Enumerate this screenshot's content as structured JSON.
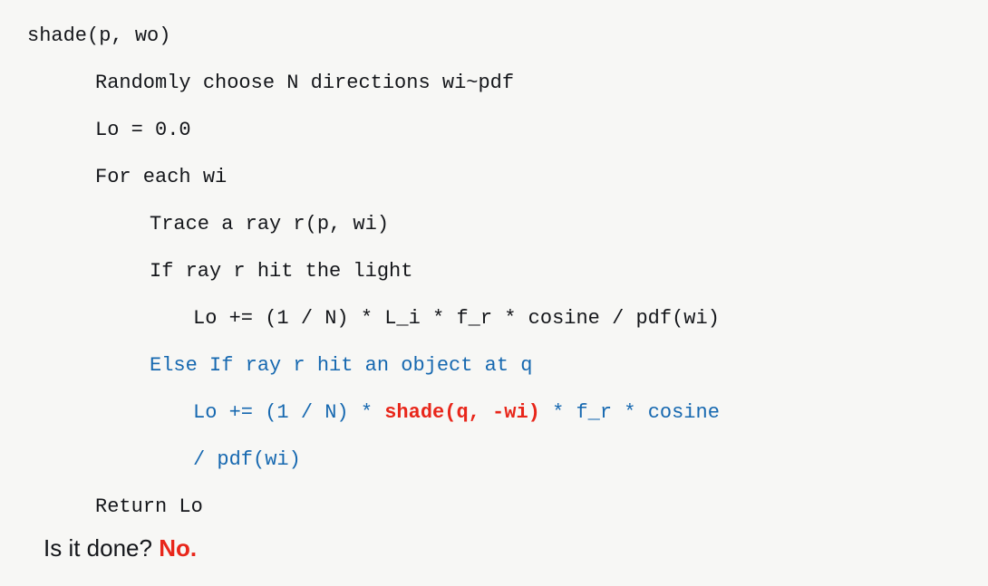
{
  "slide": {
    "background_color": "#f7f7f5",
    "text_color": "#14161a",
    "accent_blue": "#1668b0",
    "accent_red": "#e8261a"
  },
  "code": {
    "lines": [
      {
        "indent": 0,
        "color": "black",
        "text": "shade(p, wo)"
      },
      {
        "indent": 1,
        "color": "black",
        "text": "Randomly choose N directions wi~pdf"
      },
      {
        "indent": 1,
        "color": "black",
        "text": "Lo = 0.0"
      },
      {
        "indent": 1,
        "color": "black",
        "text": "For each wi"
      },
      {
        "indent": 2,
        "color": "black",
        "text": "Trace a ray r(p, wi)"
      },
      {
        "indent": 2,
        "color": "black",
        "text": "If ray r hit the light"
      },
      {
        "indent": 3,
        "color": "black",
        "text": "Lo += (1 / N) * L_i * f_r * cosine / pdf(wi)"
      },
      {
        "indent": 2,
        "color": "blue",
        "text": "Else If ray r hit an object at q"
      },
      {
        "indent": 3,
        "color": "blue",
        "wrapped": true,
        "segments": [
          {
            "text": "Lo += (1 / N) * ",
            "style": "blue"
          },
          {
            "text": "shade(q, -wi)",
            "style": "red-bold"
          },
          {
            "text": " * f_r * cosine\n/ pdf(wi)",
            "style": "blue"
          }
        ]
      },
      {
        "indent": 1,
        "color": "black",
        "text": "Return Lo"
      }
    ]
  },
  "question": {
    "prompt": "Is it done? ",
    "answer": "No."
  }
}
